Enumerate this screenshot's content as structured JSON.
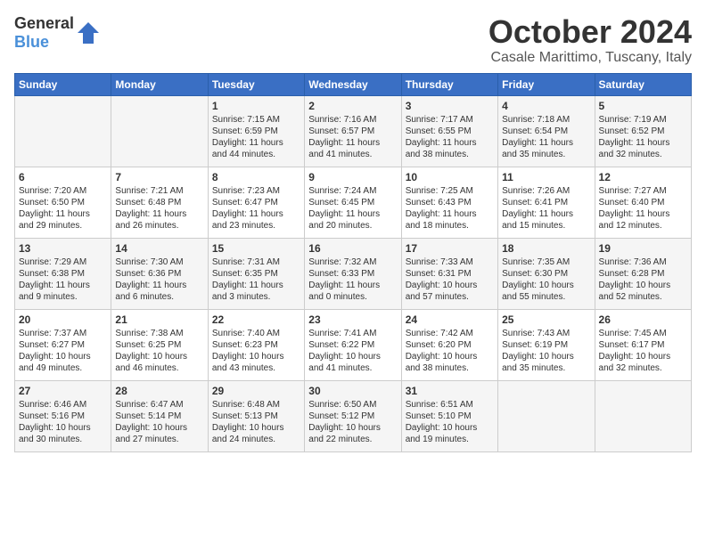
{
  "header": {
    "logo_general": "General",
    "logo_blue": "Blue",
    "title": "October 2024",
    "location": "Casale Marittimo, Tuscany, Italy"
  },
  "days_of_week": [
    "Sunday",
    "Monday",
    "Tuesday",
    "Wednesday",
    "Thursday",
    "Friday",
    "Saturday"
  ],
  "weeks": [
    [
      {
        "day": "",
        "content": ""
      },
      {
        "day": "",
        "content": ""
      },
      {
        "day": "1",
        "content": "Sunrise: 7:15 AM\nSunset: 6:59 PM\nDaylight: 11 hours\nand 44 minutes."
      },
      {
        "day": "2",
        "content": "Sunrise: 7:16 AM\nSunset: 6:57 PM\nDaylight: 11 hours\nand 41 minutes."
      },
      {
        "day": "3",
        "content": "Sunrise: 7:17 AM\nSunset: 6:55 PM\nDaylight: 11 hours\nand 38 minutes."
      },
      {
        "day": "4",
        "content": "Sunrise: 7:18 AM\nSunset: 6:54 PM\nDaylight: 11 hours\nand 35 minutes."
      },
      {
        "day": "5",
        "content": "Sunrise: 7:19 AM\nSunset: 6:52 PM\nDaylight: 11 hours\nand 32 minutes."
      }
    ],
    [
      {
        "day": "6",
        "content": "Sunrise: 7:20 AM\nSunset: 6:50 PM\nDaylight: 11 hours\nand 29 minutes."
      },
      {
        "day": "7",
        "content": "Sunrise: 7:21 AM\nSunset: 6:48 PM\nDaylight: 11 hours\nand 26 minutes."
      },
      {
        "day": "8",
        "content": "Sunrise: 7:23 AM\nSunset: 6:47 PM\nDaylight: 11 hours\nand 23 minutes."
      },
      {
        "day": "9",
        "content": "Sunrise: 7:24 AM\nSunset: 6:45 PM\nDaylight: 11 hours\nand 20 minutes."
      },
      {
        "day": "10",
        "content": "Sunrise: 7:25 AM\nSunset: 6:43 PM\nDaylight: 11 hours\nand 18 minutes."
      },
      {
        "day": "11",
        "content": "Sunrise: 7:26 AM\nSunset: 6:41 PM\nDaylight: 11 hours\nand 15 minutes."
      },
      {
        "day": "12",
        "content": "Sunrise: 7:27 AM\nSunset: 6:40 PM\nDaylight: 11 hours\nand 12 minutes."
      }
    ],
    [
      {
        "day": "13",
        "content": "Sunrise: 7:29 AM\nSunset: 6:38 PM\nDaylight: 11 hours\nand 9 minutes."
      },
      {
        "day": "14",
        "content": "Sunrise: 7:30 AM\nSunset: 6:36 PM\nDaylight: 11 hours\nand 6 minutes."
      },
      {
        "day": "15",
        "content": "Sunrise: 7:31 AM\nSunset: 6:35 PM\nDaylight: 11 hours\nand 3 minutes."
      },
      {
        "day": "16",
        "content": "Sunrise: 7:32 AM\nSunset: 6:33 PM\nDaylight: 11 hours\nand 0 minutes."
      },
      {
        "day": "17",
        "content": "Sunrise: 7:33 AM\nSunset: 6:31 PM\nDaylight: 10 hours\nand 57 minutes."
      },
      {
        "day": "18",
        "content": "Sunrise: 7:35 AM\nSunset: 6:30 PM\nDaylight: 10 hours\nand 55 minutes."
      },
      {
        "day": "19",
        "content": "Sunrise: 7:36 AM\nSunset: 6:28 PM\nDaylight: 10 hours\nand 52 minutes."
      }
    ],
    [
      {
        "day": "20",
        "content": "Sunrise: 7:37 AM\nSunset: 6:27 PM\nDaylight: 10 hours\nand 49 minutes."
      },
      {
        "day": "21",
        "content": "Sunrise: 7:38 AM\nSunset: 6:25 PM\nDaylight: 10 hours\nand 46 minutes."
      },
      {
        "day": "22",
        "content": "Sunrise: 7:40 AM\nSunset: 6:23 PM\nDaylight: 10 hours\nand 43 minutes."
      },
      {
        "day": "23",
        "content": "Sunrise: 7:41 AM\nSunset: 6:22 PM\nDaylight: 10 hours\nand 41 minutes."
      },
      {
        "day": "24",
        "content": "Sunrise: 7:42 AM\nSunset: 6:20 PM\nDaylight: 10 hours\nand 38 minutes."
      },
      {
        "day": "25",
        "content": "Sunrise: 7:43 AM\nSunset: 6:19 PM\nDaylight: 10 hours\nand 35 minutes."
      },
      {
        "day": "26",
        "content": "Sunrise: 7:45 AM\nSunset: 6:17 PM\nDaylight: 10 hours\nand 32 minutes."
      }
    ],
    [
      {
        "day": "27",
        "content": "Sunrise: 6:46 AM\nSunset: 5:16 PM\nDaylight: 10 hours\nand 30 minutes."
      },
      {
        "day": "28",
        "content": "Sunrise: 6:47 AM\nSunset: 5:14 PM\nDaylight: 10 hours\nand 27 minutes."
      },
      {
        "day": "29",
        "content": "Sunrise: 6:48 AM\nSunset: 5:13 PM\nDaylight: 10 hours\nand 24 minutes."
      },
      {
        "day": "30",
        "content": "Sunrise: 6:50 AM\nSunset: 5:12 PM\nDaylight: 10 hours\nand 22 minutes."
      },
      {
        "day": "31",
        "content": "Sunrise: 6:51 AM\nSunset: 5:10 PM\nDaylight: 10 hours\nand 19 minutes."
      },
      {
        "day": "",
        "content": ""
      },
      {
        "day": "",
        "content": ""
      }
    ]
  ]
}
